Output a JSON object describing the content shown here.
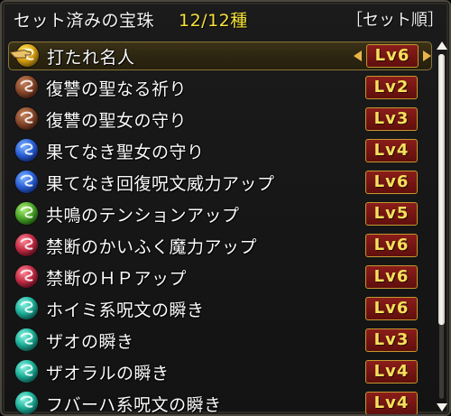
{
  "header": {
    "title": "セット済みの宝珠",
    "count": "12/12種",
    "sort_button": "［セット順］"
  },
  "orb_colors": {
    "yellow": [
      "#fff06a",
      "#d9a313",
      "#6b4b06"
    ],
    "brown": [
      "#c88560",
      "#8a4a2c",
      "#3a1a0e"
    ],
    "blue": [
      "#82b7ff",
      "#2c63d9",
      "#0d2468"
    ],
    "green": [
      "#b4f27d",
      "#4ea82a",
      "#174b0c"
    ],
    "red": [
      "#ff8b9a",
      "#c52e47",
      "#4c0b18"
    ],
    "teal": [
      "#8ff6e4",
      "#1fb29c",
      "#0a4a42"
    ]
  },
  "items": [
    {
      "name": "打たれ名人",
      "level": "Lv6",
      "orb": "yellow",
      "selected": true
    },
    {
      "name": "復讐の聖なる祈り",
      "level": "Lv2",
      "orb": "brown"
    },
    {
      "name": "復讐の聖女の守り",
      "level": "Lv3",
      "orb": "brown"
    },
    {
      "name": "果てなき聖女の守り",
      "level": "Lv4",
      "orb": "blue"
    },
    {
      "name": "果てなき回復呪文威力アップ",
      "level": "Lv6",
      "orb": "blue"
    },
    {
      "name": "共鳴のテンションアップ",
      "level": "Lv5",
      "orb": "green"
    },
    {
      "name": "禁断のかいふく魔力アップ",
      "level": "Lv6",
      "orb": "red"
    },
    {
      "name": "禁断のＨＰアップ",
      "level": "Lv6",
      "orb": "red"
    },
    {
      "name": "ホイミ系呪文の瞬き",
      "level": "Lv6",
      "orb": "teal"
    },
    {
      "name": "ザオの瞬き",
      "level": "Lv3",
      "orb": "teal"
    },
    {
      "name": "ザオラルの瞬き",
      "level": "Lv4",
      "orb": "teal"
    },
    {
      "name": "フバーハ系呪文の瞬き",
      "level": "Lv4",
      "orb": "teal"
    }
  ],
  "scroll_position": 0.0
}
